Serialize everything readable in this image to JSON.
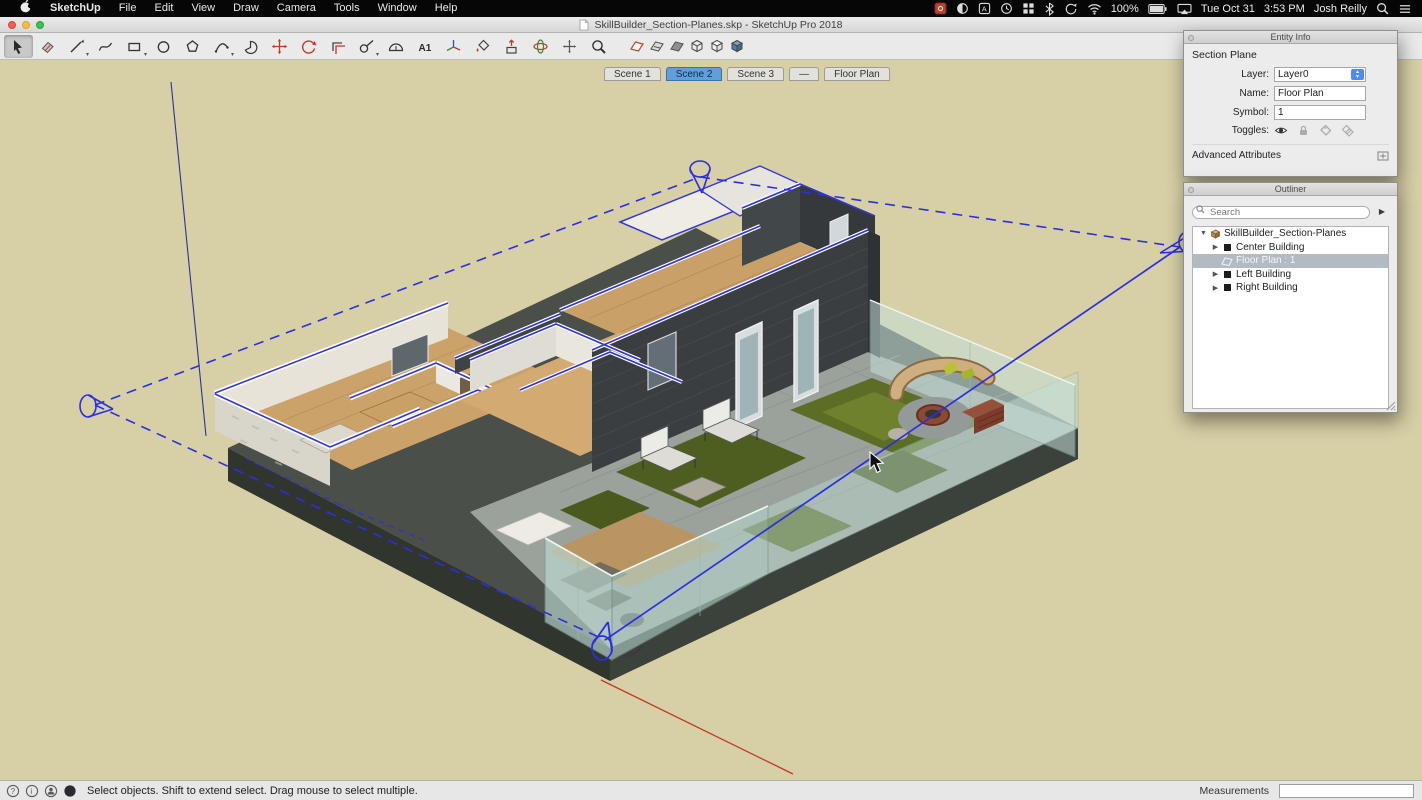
{
  "colors": {
    "viewport_bg": "#d7cfa5",
    "section_blue": "#2b2fe2",
    "scene_tab_active": "#5f9fdc",
    "menu_bar_bg": "#060606",
    "red_axis": "#c3372a",
    "blue_axis": "#27339b",
    "dark_wall": "#3a3e41",
    "wood_floor": "#cba26a",
    "grass_green": "#5c6d26",
    "paver_gray": "#9ba29b"
  },
  "menu_bar": {
    "app_name": "SketchUp",
    "items": [
      "File",
      "Edit",
      "View",
      "Draw",
      "Camera",
      "Tools",
      "Window",
      "Help"
    ],
    "status_right": {
      "battery": "100%",
      "date": "Tue Oct 31",
      "time": "3:53 PM",
      "user": "Josh Reilly"
    },
    "icons": [
      "red-app",
      "flux",
      "input-source",
      "clock",
      "grid",
      "bluetooth",
      "time-machine",
      "wifi",
      "battery",
      "airplay",
      "spotlight",
      "notification-center"
    ]
  },
  "title_bar": {
    "title": "SkillBuilder_Section-Planes.skp - SketchUp Pro 2018"
  },
  "toolbar": {
    "tools": [
      "select",
      "eraser",
      "line",
      "freehand",
      "rectangle",
      "circle",
      "polygon",
      "arc",
      "pie",
      "move",
      "rotate",
      "offset",
      "tape-measure",
      "protractor",
      "text",
      "axes",
      "paint-bucket",
      "push-pull",
      "orbit",
      "pan",
      "zoom"
    ],
    "view_toggles": [
      "display-section-planes",
      "display-section-cuts",
      "display-section-fill",
      "style-wireframe",
      "style-hidden-line",
      "style-shaded"
    ]
  },
  "scene_tabs": [
    {
      "label": "Scene 1",
      "active": false
    },
    {
      "label": "Scene 2",
      "active": true
    },
    {
      "label": "Scene 3",
      "active": false
    },
    {
      "label": "—",
      "active": false
    },
    {
      "label": "Floor Plan",
      "active": false
    }
  ],
  "entity_info": {
    "title": "Entity Info",
    "entity_type": "Section Plane",
    "fields": {
      "layer_label": "Layer:",
      "layer_value": "Layer0",
      "name_label": "Name:",
      "name_value": "Floor Plan",
      "symbol_label": "Symbol:",
      "symbol_value": "1",
      "toggles_label": "Toggles:"
    },
    "toggle_icons": [
      "visible-eye",
      "lock",
      "tag",
      "tags"
    ],
    "advanced_attributes_label": "Advanced Attributes"
  },
  "outliner": {
    "title": "Outliner",
    "search_placeholder": "Search",
    "tree": [
      {
        "label": "SkillBuilder_Section-Planes",
        "level": 0,
        "icon": "model",
        "expanded": true,
        "selected": false
      },
      {
        "label": "Center Building",
        "level": 1,
        "icon": "component",
        "selected": false
      },
      {
        "label": "Floor Plan : 1",
        "level": 1,
        "icon": "section-plane",
        "selected": true
      },
      {
        "label": "Left Building",
        "level": 1,
        "icon": "component",
        "selected": false
      },
      {
        "label": "Right Building",
        "level": 1,
        "icon": "component",
        "selected": false
      }
    ]
  },
  "status_bar": {
    "hint": "Select objects. Shift to extend select. Drag mouse to select multiple.",
    "measurements_label": "Measurements",
    "measurements_value": ""
  }
}
